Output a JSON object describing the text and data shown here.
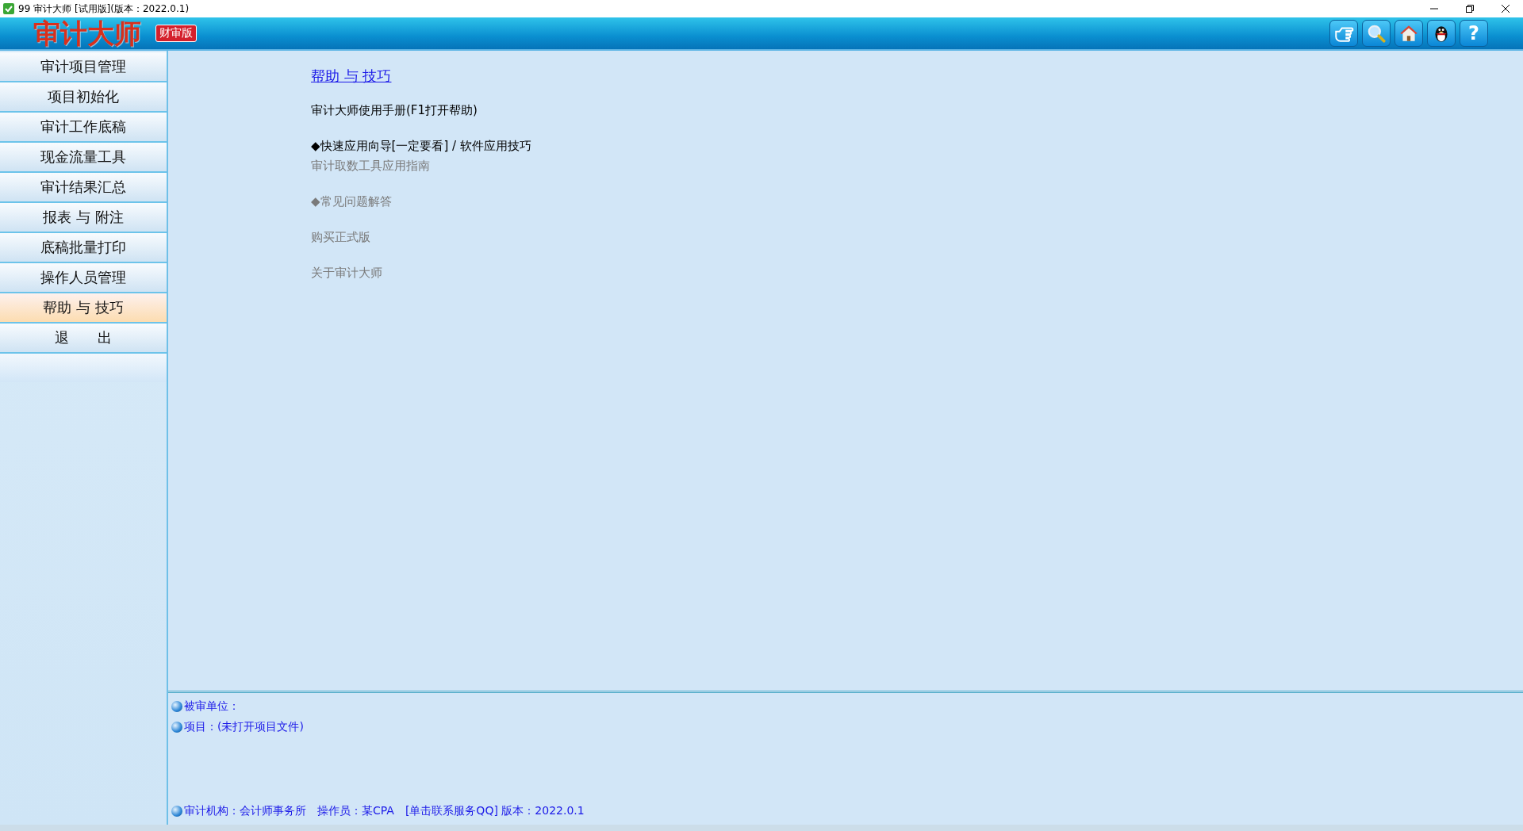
{
  "window": {
    "title": "99 审计大师 [试用版](版本：2022.0.1)"
  },
  "header": {
    "logo": "审计大师",
    "edition_badge": "财审版",
    "toolbar": [
      {
        "kind": "pointer"
      },
      {
        "kind": "search"
      },
      {
        "kind": "home"
      },
      {
        "kind": "penguin"
      },
      {
        "kind": "help",
        "label": "?"
      }
    ]
  },
  "sidebar": {
    "items": [
      {
        "label": "审计项目管理",
        "selected": false
      },
      {
        "label": "项目初始化",
        "selected": false
      },
      {
        "label": "审计工作底稿",
        "selected": false
      },
      {
        "label": "现金流量工具",
        "selected": false
      },
      {
        "label": "审计结果汇总",
        "selected": false
      },
      {
        "label": "报表 与 附注",
        "selected": false
      },
      {
        "label": "底稿批量打印",
        "selected": false
      },
      {
        "label": "操作人员管理",
        "selected": false
      },
      {
        "label": "帮助 与 技巧",
        "selected": true
      },
      {
        "label": "退　　出",
        "selected": false
      }
    ]
  },
  "content": {
    "heading": "帮助 与 技巧",
    "groups": [
      [
        {
          "label": "审计大师使用手册(F1打开帮助)",
          "disabled": false
        }
      ],
      [
        {
          "label": "◆快速应用向导[一定要看] / 软件应用技巧",
          "disabled": false
        },
        {
          "label": "审计取数工具应用指南",
          "disabled": true
        }
      ],
      [
        {
          "label": "◆常见问题解答",
          "disabled": true
        }
      ],
      [
        {
          "label": "购买正式版",
          "disabled": true
        }
      ],
      [
        {
          "label": "关于审计大师",
          "disabled": true
        }
      ]
    ]
  },
  "info": {
    "lines": [
      "被审单位：",
      "项目：(未打开项目文件)"
    ],
    "status": "审计机构：会计师事务所　操作员：某CPA　[单击联系服务QQ] 版本：2022.0.1"
  }
}
